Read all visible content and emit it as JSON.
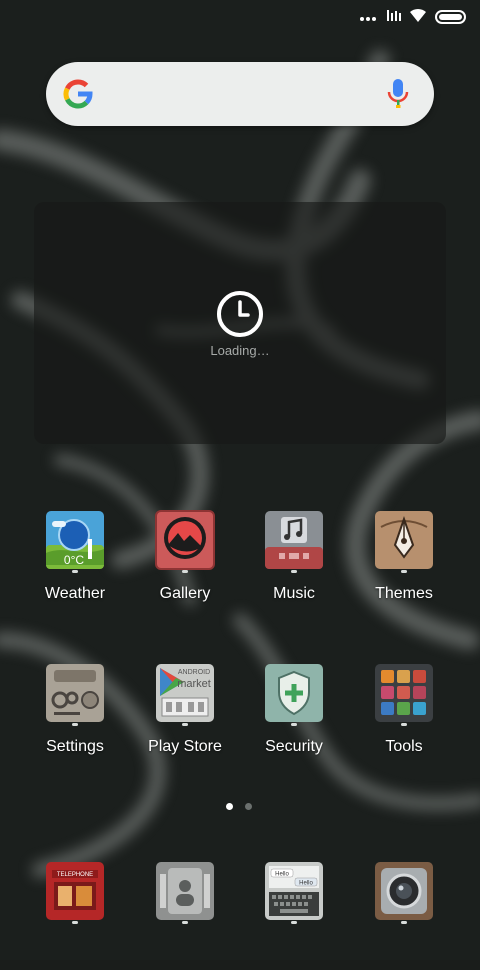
{
  "status_bar": {
    "icons": [
      "more-dots-icon",
      "signal-icon",
      "wifi-icon",
      "battery-icon"
    ]
  },
  "search": {
    "logo": "google-g-icon",
    "mic": "mic-icon",
    "colors": {
      "blue": "#4285F4",
      "red": "#EA4335",
      "yellow": "#FBBC05",
      "green": "#34A853"
    }
  },
  "clock_widget": {
    "icon": "clock-icon",
    "loading_text": "Loading…"
  },
  "apps_row1": [
    {
      "label": "Weather",
      "icon": "weather-icon"
    },
    {
      "label": "Gallery",
      "icon": "gallery-icon"
    },
    {
      "label": "Music",
      "icon": "music-icon"
    },
    {
      "label": "Themes",
      "icon": "themes-icon"
    }
  ],
  "apps_row2": [
    {
      "label": "Settings",
      "icon": "settings-icon"
    },
    {
      "label": "Play Store",
      "icon": "play-store-icon"
    },
    {
      "label": "Security",
      "icon": "security-icon"
    },
    {
      "label": "Tools",
      "icon": "tools-icon"
    }
  ],
  "weather_icon_text": "0°C",
  "playstore_icon_text": {
    "line1": "ANDROID",
    "line2": "market"
  },
  "page_indicator": {
    "current": 1,
    "total": 2
  },
  "dock": [
    {
      "icon": "phone-booth-icon",
      "text": "TELEPHONE"
    },
    {
      "icon": "contacts-icon"
    },
    {
      "icon": "messaging-icon",
      "bubble1": "Hello",
      "bubble2": "Hello"
    },
    {
      "icon": "camera-icon"
    }
  ]
}
